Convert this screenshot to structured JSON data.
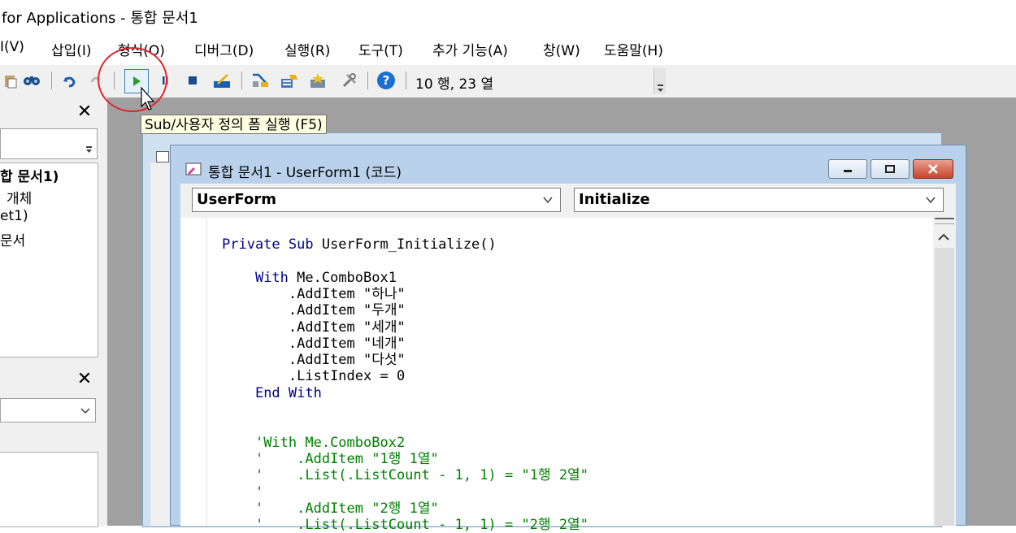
{
  "window": {
    "title": "for Applications - 통합 문서1"
  },
  "menu": [
    {
      "label": "I(V)"
    },
    {
      "label": "삽입(I)"
    },
    {
      "label": "형식(O)"
    },
    {
      "label": "디버그(D)"
    },
    {
      "label": "실행(R)"
    },
    {
      "label": "도구(T)"
    },
    {
      "label": "추가 기능(A)"
    },
    {
      "label": "창(W)"
    },
    {
      "label": "도움말(H)"
    }
  ],
  "toolbar": {
    "position_text": "10 행, 23 열",
    "tooltip": "Sub/사용자 정의 폼 실행 (F5)",
    "icons": [
      "paste-icon",
      "find-icon",
      "undo-icon",
      "redo-icon",
      "run-icon",
      "break-icon",
      "reset-icon",
      "design-mode-icon",
      "project-explorer-icon",
      "properties-icon",
      "object-browser-icon",
      "toolbox-icon",
      "help-icon"
    ]
  },
  "project_panel": {
    "items": [
      "합 문서1)",
      "개체",
      "et1)",
      "문서"
    ]
  },
  "code_window": {
    "title": "통합 문서1 - UserForm1 (코드)",
    "object_combo": "UserForm",
    "procedure_combo": "Initialize",
    "lines": [
      {
        "indent": "",
        "tokens": [
          {
            "t": "Private Sub",
            "k": "kw"
          },
          {
            "t": " UserForm_Initialize()",
            "k": ""
          }
        ]
      },
      {
        "indent": "",
        "tokens": []
      },
      {
        "indent": "    ",
        "tokens": [
          {
            "t": "With",
            "k": "kw"
          },
          {
            "t": " Me.ComboBox1",
            "k": ""
          }
        ]
      },
      {
        "indent": "        ",
        "tokens": [
          {
            "t": ".AddItem \"하나\"",
            "k": ""
          }
        ]
      },
      {
        "indent": "        ",
        "tokens": [
          {
            "t": ".AddItem \"두개\"",
            "k": ""
          }
        ]
      },
      {
        "indent": "        ",
        "tokens": [
          {
            "t": ".AddItem \"세개\"",
            "k": ""
          }
        ]
      },
      {
        "indent": "        ",
        "tokens": [
          {
            "t": ".AddItem \"네개\"",
            "k": ""
          }
        ]
      },
      {
        "indent": "        ",
        "tokens": [
          {
            "t": ".AddItem \"다섯\"",
            "k": ""
          }
        ]
      },
      {
        "indent": "        ",
        "tokens": [
          {
            "t": ".ListIndex = 0",
            "k": ""
          }
        ]
      },
      {
        "indent": "    ",
        "tokens": [
          {
            "t": "End With",
            "k": "kw"
          }
        ]
      },
      {
        "indent": "",
        "tokens": []
      },
      {
        "indent": "",
        "tokens": []
      },
      {
        "indent": "    ",
        "tokens": [
          {
            "t": "'With Me.ComboBox2",
            "k": "cm"
          }
        ]
      },
      {
        "indent": "    ",
        "tokens": [
          {
            "t": "'    .AddItem \"1행 1열\"",
            "k": "cm"
          }
        ]
      },
      {
        "indent": "    ",
        "tokens": [
          {
            "t": "'    .List(.ListCount - 1, 1) = \"1행 2열\"",
            "k": "cm"
          }
        ]
      },
      {
        "indent": "    ",
        "tokens": [
          {
            "t": "'",
            "k": "cm"
          }
        ]
      },
      {
        "indent": "    ",
        "tokens": [
          {
            "t": "'    .AddItem \"2행 1열\"",
            "k": "cm"
          }
        ]
      },
      {
        "indent": "    ",
        "tokens": [
          {
            "t": "'    .List(.ListCount - 1, 1) = \"2행 2열\"",
            "k": "cm"
          }
        ]
      }
    ]
  }
}
